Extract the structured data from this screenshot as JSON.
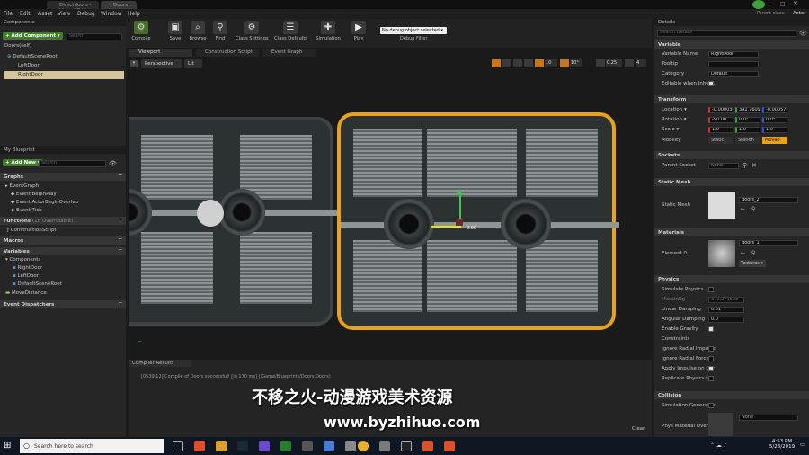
{
  "window": {
    "tabs": [
      "Directdoors - Unreal Editor",
      "Doors"
    ],
    "title": "Parent class:",
    "parent_class": "Actor"
  },
  "menu": [
    "File",
    "Edit",
    "Asset",
    "View",
    "Debug",
    "Window",
    "Help"
  ],
  "toolbar": {
    "compile": "Compile",
    "save": "Save",
    "browse": "Browse",
    "find": "Find",
    "class_settings": "Class Settings",
    "class_defaults": "Class Defaults",
    "simulation": "Simulation",
    "play": "Play",
    "debug_select": "No debug object selected ▾",
    "debug_filter": "Debug Filter"
  },
  "components": {
    "tab": "Components",
    "add_button": "+ Add Component ▾",
    "search_placeholder": "Search",
    "self": "Doors(self)",
    "root": "DefaultSceneRoot",
    "items": [
      "LeftDoor",
      "RightDoor"
    ]
  },
  "my_blueprint": {
    "tab": "My Blueprint",
    "add_new": "+ Add New ▾",
    "search_placeholder": "Search",
    "graphs_header": "Graphs",
    "event_graph": "EventGraph",
    "events": [
      "Event BeginPlay",
      "Event ActorBeginOverlap",
      "Event Tick"
    ],
    "functions_header": "Functions",
    "functions_count": "(16 Overridable)",
    "construction": "ConstructionScript",
    "macros_header": "Macros",
    "variables_header": "Variables",
    "components_header": "Components",
    "variable_items": [
      "RightDoor",
      "LeftDoor",
      "DefaultSceneRoot"
    ],
    "move_distance": "MoveDistance",
    "dispatchers_header": "Event Dispatchers"
  },
  "editor_tabs": [
    "Viewport",
    "Construction Script",
    "Event Graph"
  ],
  "viewport": {
    "perspective": "Perspective",
    "lit": "Lit",
    "snap_values": [
      "10",
      "10°",
      "0.25",
      "4"
    ],
    "gizmo_value": "0.00"
  },
  "compiler": {
    "tab": "Compiler Results",
    "message": "[0539.12] Compile of Doors successful! [in 170 ms] (/Game/Blueprints/Doors.Doors)",
    "clear": "Clear"
  },
  "details": {
    "tab": "Details",
    "search_placeholder": "Search Details",
    "variable_header": "Variable",
    "variable_name_label": "Variable Name",
    "variable_name": "RightDoor",
    "tooltip_label": "Tooltip",
    "category_label": "Category",
    "category_value": "Default",
    "editable_label": "Editable when Inherit",
    "transform_header": "Transform",
    "location_label": "Location ▾",
    "location": [
      "-0.000030",
      "392.76090",
      "-0.000576"
    ],
    "rotation_label": "Rotation ▾",
    "rotation": [
      "-90.00",
      "0.0°",
      "0.0°"
    ],
    "scale_label": "Scale ▾",
    "scale": [
      "1.0",
      "1.0",
      "1.0"
    ],
    "mobility_label": "Mobility",
    "mobility": [
      "Static",
      "Station",
      "Movab"
    ],
    "sockets_header": "Sockets",
    "parent_socket_label": "Parent Socket",
    "parent_socket": "None",
    "static_mesh_header": "Static Mesh",
    "static_mesh_label": "Static Mesh",
    "static_mesh_value": "doors_2",
    "materials_header": "Materials",
    "element_label": "Element 0",
    "material_value": "doors_1",
    "textures_btn": "Textures ▾",
    "physics_header": "Physics",
    "physics_rows": [
      "Simulate Physics",
      "MassInKg",
      "Linear Damping",
      "Angular Damping",
      "Enable Gravity",
      "Constraints",
      "Ignore Radial Impulse",
      "Ignore Radial Force",
      "Apply Impulse on Dar",
      "Replicate Physics to"
    ],
    "mass_value": "371.271603",
    "linear_damping": "0.01",
    "angular_damping": "0.0",
    "collision_header": "Collision",
    "collision_rows": [
      "Simulation Generates",
      "Phys Material Overri"
    ],
    "phys_material_value": "None"
  },
  "watermark": {
    "line1": "不移之火-动漫游戏美术资源",
    "line2": "www.byzhihuo.com"
  },
  "taskbar": {
    "search_placeholder": "Search here to search",
    "time": "4:53 PM",
    "date": "5/23/2019"
  },
  "colors": {
    "accent_orange": "#e8a317",
    "add_green": "#3f7d2a",
    "selected_row": "#d6c49a",
    "taskbar": "#0f1722"
  }
}
